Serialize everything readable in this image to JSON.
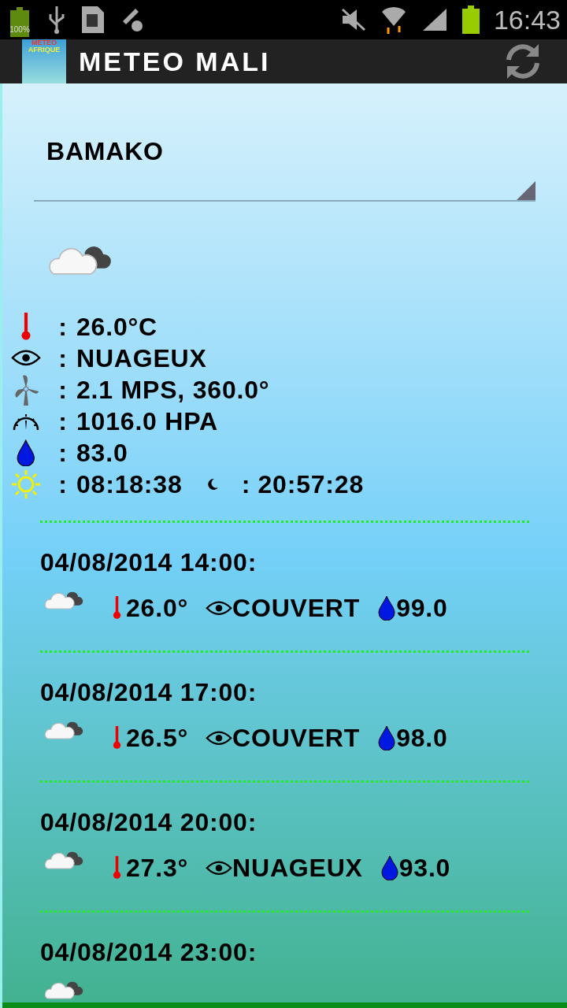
{
  "status_bar": {
    "battery_percent": "100%",
    "time": "16:43"
  },
  "app_bar": {
    "logo_top": "METEO",
    "logo_bottom": "AFRIQUE",
    "title": "METEO MALI"
  },
  "city_select": {
    "value": "BAMAKO"
  },
  "current": [
    {
      "kind": "temperature",
      "sep": ":",
      "value": "26.0°C"
    },
    {
      "kind": "condition",
      "sep": ":",
      "value": "NUAGEUX"
    },
    {
      "kind": "wind",
      "sep": ":",
      "value": "2.1 MPS, 360.0°"
    },
    {
      "kind": "pressure",
      "sep": ":",
      "value": "1016.0 HPA"
    },
    {
      "kind": "humidity",
      "sep": ":",
      "value": "83.0"
    },
    {
      "kind": "sun",
      "sep": ":",
      "value": "08:18:38",
      "sunset_sep": ":",
      "sunset": "20:57:28"
    }
  ],
  "forecasts": [
    {
      "kind": "full",
      "time": "04/08/2014 14:00:",
      "temperature": "26.0°",
      "condition": "COUVERT",
      "humidity": "99.0"
    },
    {
      "kind": "full",
      "time": "04/08/2014 17:00:",
      "temperature": "26.5°",
      "condition": "COUVERT",
      "humidity": "98.0"
    },
    {
      "kind": "full",
      "time": "04/08/2014 20:00:",
      "temperature": "27.3°",
      "condition": "NUAGEUX",
      "humidity": "93.0"
    },
    {
      "kind": "cut",
      "time": "04/08/2014 23:00:"
    }
  ]
}
